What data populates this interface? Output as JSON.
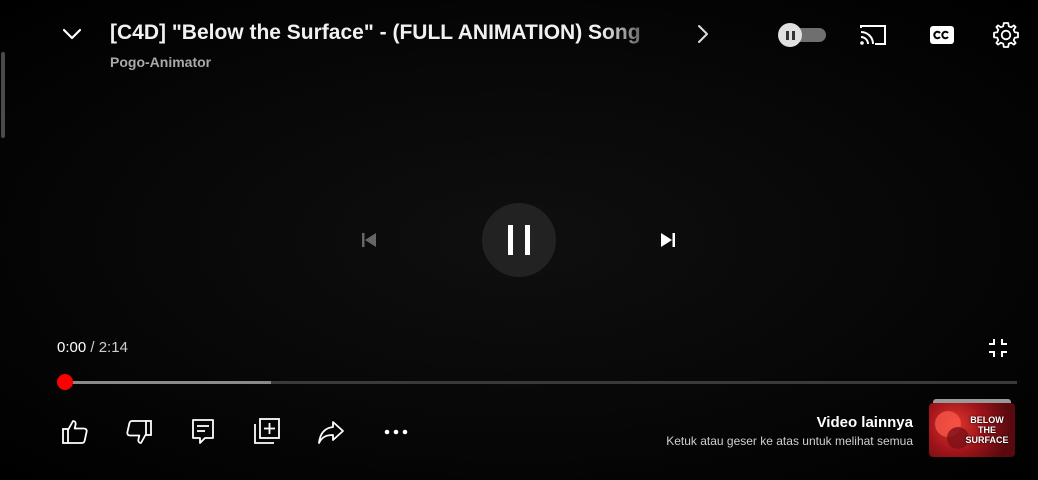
{
  "header": {
    "title": "[C4D] \"Below the Surface\" - (FULL ANIMATION) Song",
    "channel": "Pogo-Animator"
  },
  "playback": {
    "current_time": "0:00",
    "separator": "/",
    "duration": "2:14",
    "played_fraction": 0.0,
    "buffered_fraction": 0.216,
    "autoplay_on": false
  },
  "more_videos": {
    "title": "Video lainnya",
    "subtitle": "Ketuk atau geser ke atas untuk melihat semua",
    "thumbnail_text": "BELOW THE SURFACE"
  },
  "icons": {
    "collapse": "chevron-down-icon",
    "next_title": "chevron-right-icon",
    "autoplay": "autoplay-toggle",
    "cast": "cast-icon",
    "captions": "captions-icon",
    "settings": "gear-icon",
    "previous": "previous-track-icon",
    "pause": "pause-icon",
    "next": "next-track-icon",
    "exit_fullscreen": "exit-fullscreen-icon",
    "like": "thumbs-up-icon",
    "dislike": "thumbs-down-icon",
    "comments": "comments-icon",
    "save": "add-to-playlist-icon",
    "share": "share-icon",
    "more": "more-horiz-icon"
  },
  "colors": {
    "progress_played": "#ff0000",
    "progress_buffered": "#8a8a8a",
    "progress_track": "#3a3a3a",
    "background": "#000000"
  }
}
